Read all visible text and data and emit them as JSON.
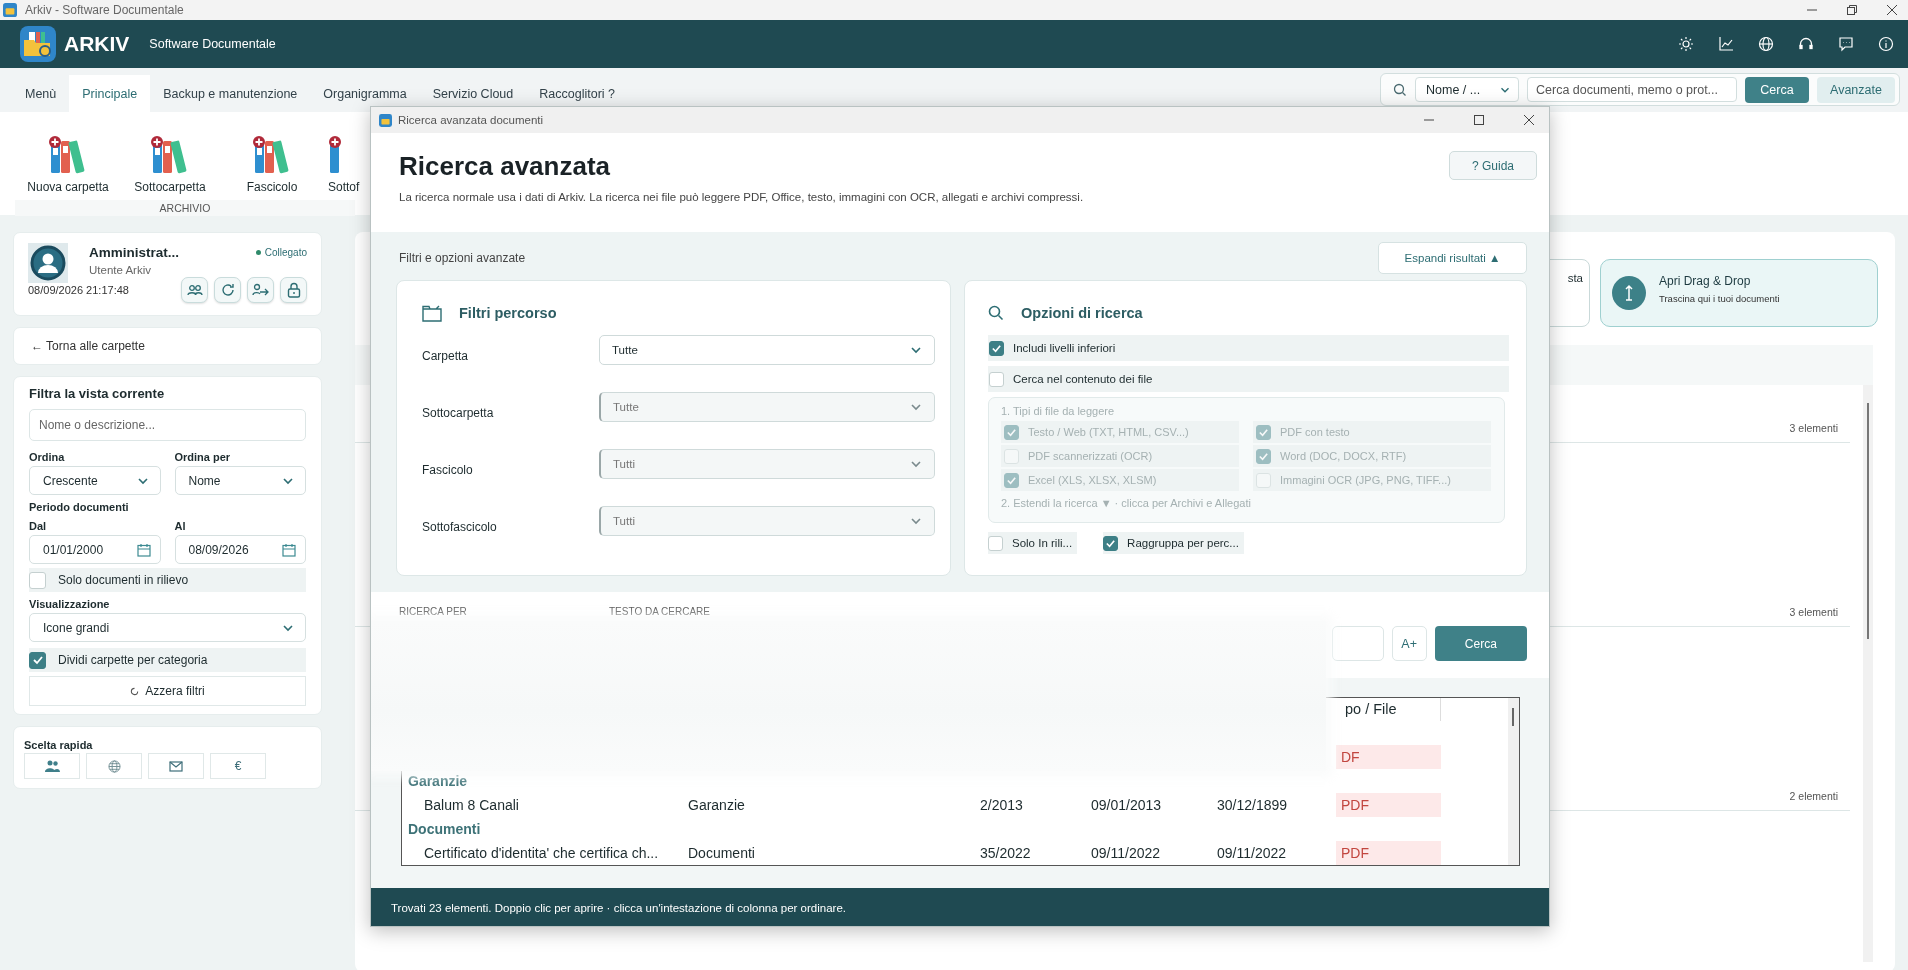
{
  "window": {
    "title": "Arkiv - Software Documentale"
  },
  "header": {
    "brand": "ARKIV",
    "subtitle": "Software Documentale"
  },
  "tabs": [
    {
      "label": "Menù",
      "selected": false
    },
    {
      "label": "Principale",
      "selected": true
    },
    {
      "label": "Backup e manutenzione",
      "selected": false
    },
    {
      "label": "Organigramma",
      "selected": false
    },
    {
      "label": "Servizio Cloud",
      "selected": false
    },
    {
      "label": "Raccoglitori ?",
      "selected": false
    }
  ],
  "quick_search": {
    "field": "Nome / ...",
    "placeholder": "Cerca documenti, memo o prot...",
    "search_button": "Cerca",
    "advanced_button": "Avanzate"
  },
  "ribbon": {
    "items": [
      {
        "label": "Nuova carpetta"
      },
      {
        "label": "Sottocarpetta"
      },
      {
        "label": "Fascicolo"
      },
      {
        "label": "Sottof"
      }
    ],
    "group": "ARCHIVIO"
  },
  "user": {
    "name": "Amministrat...",
    "role": "Utente Arkiv",
    "status": "Collegato",
    "datetime": "08/09/2026 21:17:48"
  },
  "back_link": "← Torna alle carpette",
  "filter": {
    "title": "Filtra la vista corrente",
    "search_placeholder": "Nome o descrizione...",
    "order_label": "Ordina",
    "order": "Crescente",
    "order_by_label": "Ordina per",
    "order_by": "Nome",
    "period_label": "Periodo documenti",
    "from_label": "Dal",
    "from": "01/01/2000",
    "to_label": "Al",
    "to": "08/09/2026",
    "highlighted_only": {
      "label": "Solo documenti in rilievo",
      "checked": false
    },
    "view_label": "Visualizzazione",
    "view": "Icone grandi",
    "split_by_category": {
      "label": "Dividi carpette per categoria",
      "checked": true
    },
    "reset": "Azzera filtri"
  },
  "quick_choice": {
    "title": "Scelta rapida",
    "buttons": [
      {
        "kind": "people"
      },
      {
        "kind": "globe"
      },
      {
        "kind": "mail"
      },
      {
        "kind": "text",
        "label": "€"
      }
    ]
  },
  "main": {
    "partial_card": "sta",
    "drop_card": {
      "title": "Apri Drag & Drop",
      "subtitle": "Trascina qui i tuoi documenti"
    },
    "sections": [
      {
        "count": "3 elementi"
      },
      {
        "count": "3 elementi"
      },
      {
        "count": "2 elementi"
      }
    ]
  },
  "dialog": {
    "title": "Ricerca avanzata documenti",
    "heading": "Ricerca avanzata",
    "description": "La ricerca normale usa i dati di Arkiv. La ricerca nei file può leggere PDF, Office, testo, immagini con OCR, allegati e archivi compressi.",
    "help_button": "? Guida",
    "options_title": "Filtri e opzioni avanzate",
    "expand_button": "Espandi risultati ▲",
    "path_filters": {
      "title": "Filtri percorso",
      "fields": [
        {
          "label": "Carpetta",
          "value": "Tutte",
          "disabled": false
        },
        {
          "label": "Sottocarpetta",
          "value": "Tutte",
          "disabled": true
        },
        {
          "label": "Fascicolo",
          "value": "Tutti",
          "disabled": true
        },
        {
          "label": "Sottofascicolo",
          "value": "Tutti",
          "disabled": true
        }
      ]
    },
    "search_options": {
      "title": "Opzioni di ricerca",
      "options": [
        {
          "label": "Includi livelli inferiori",
          "checked": true
        },
        {
          "label": "Cerca nel contenuto dei file",
          "checked": false
        }
      ],
      "file_types": {
        "title": "1. Tipi di file da leggere",
        "disabled": true,
        "types": [
          {
            "label": "Testo / Web (TXT, HTML, CSV...)",
            "checked": true
          },
          {
            "label": "PDF con testo",
            "checked": true
          },
          {
            "label": "PDF scannerizzati (OCR)",
            "checked": false
          },
          {
            "label": "Word (DOC, DOCX, RTF)",
            "checked": true
          },
          {
            "label": "Excel (XLS, XLSX, XLSM)",
            "checked": true
          },
          {
            "label": "Immagini OCR (JPG, PNG, TIFF...)",
            "checked": false
          }
        ],
        "extend": "2. Estendi la ricerca ▼ · clicca per Archivi e Allegati"
      },
      "extra": [
        {
          "label": "Solo In rili...",
          "checked": false
        },
        {
          "label": "Raggruppa per perc...",
          "checked": true
        }
      ]
    },
    "search_by_label": "RICERCA PER",
    "text_label": "TESTO DA CERCARE",
    "font_button": "A+",
    "search_button": "Cerca",
    "results": {
      "column_6": "po / File",
      "rows": [
        {
          "kind": "group"
        },
        {
          "kind": "row",
          "column_6": "DF"
        },
        {
          "kind": "group",
          "label": "Garanzie"
        },
        {
          "kind": "row",
          "cells": [
            "Balum 8 Canali",
            "Garanzie",
            "2/2013",
            "09/01/2013",
            "30/12/1899"
          ],
          "column_6": "PDF"
        },
        {
          "kind": "group",
          "label": "Documenti"
        },
        {
          "kind": "row",
          "cells": [
            "Certificato d'identita' che certifica ch...",
            "Documenti",
            "35/2022",
            "09/11/2022",
            "09/11/2022"
          ],
          "column_6": "PDF"
        }
      ]
    },
    "status": "Trovati 23 elementi. Doppio clic per aprire · clicca un'intestazione di colonna per ordinare."
  }
}
